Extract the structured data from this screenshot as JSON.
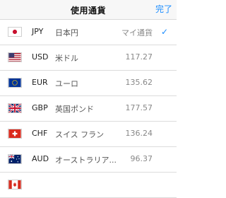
{
  "navbar": {
    "title": "使用通貨",
    "done_label": "完了"
  },
  "colors": {
    "accent": "#1a8cff"
  },
  "currencies": [
    {
      "code": "JPY",
      "name": "日本円",
      "rate": "マイ通貨",
      "selected": true,
      "flag": "jp-flag-icon",
      "check_icon": "checkmark-icon",
      "check": "✓"
    },
    {
      "code": "USD",
      "name": "米ドル",
      "rate": "117.27",
      "flag": "us-flag-icon"
    },
    {
      "code": "EUR",
      "name": "ユーロ",
      "rate": "135.62",
      "flag": "eu-flag-icon"
    },
    {
      "code": "GBP",
      "name": "英国ポンド",
      "rate": "177.57",
      "flag": "uk-flag-icon"
    },
    {
      "code": "CHF",
      "name": "スイス フラン",
      "rate": "136.24",
      "flag": "ch-flag-icon"
    },
    {
      "code": "AUD",
      "name": "オーストラリア...",
      "rate": "96.37",
      "flag": "au-flag-icon"
    }
  ]
}
